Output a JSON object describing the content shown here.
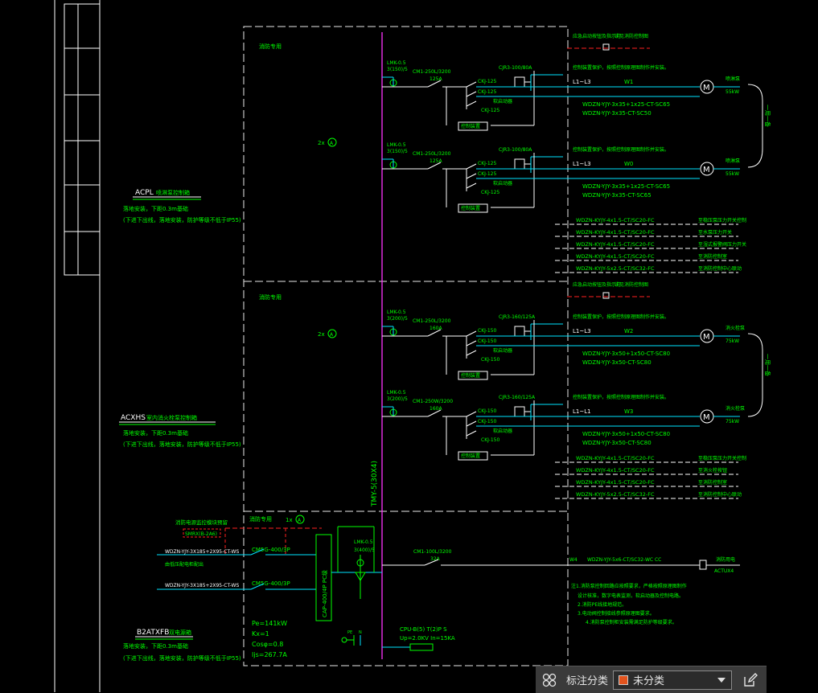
{
  "colors": {
    "background": "#000000",
    "frame": "#ffffff",
    "dashed": "#e8e8e8",
    "green": "#00ff00",
    "cyan": "#00e5ff",
    "magenta": "#ff33ff",
    "red": "#ff2020",
    "toolbar_bg": "#3a3a3a",
    "swatch": "#e2531d"
  },
  "panels": [
    {
      "code": "ACPL",
      "name": "喷淋泵控制箱",
      "line2": "落地安装，下距0.3m基础",
      "line3": "(下进下出线，落地安装，防护等级不低于IP55)"
    },
    {
      "code": "ACXHS",
      "name": "室内消火栓泵控制箱",
      "line2": "落地安装，下距0.3m基础",
      "line3": "(下进下出线，落地安装，防护等级不低于IP55)"
    },
    {
      "code": "B2ATXFB",
      "name": "双电源箱",
      "line2": "落地安装，下距0.3m基础",
      "line3": "(下进下出线，落地安装，防护等级不低于IP55)"
    }
  ],
  "section_labels": [
    "消防专用",
    "消防专用",
    "消防专用"
  ],
  "busbar_label": "TMY-5(30X4)",
  "two_x": "2x",
  "one_x": "1x",
  "motor_circuits": [
    {
      "meter": "LMK-0.5",
      "ct": "3(150)/5",
      "breaker": "CM1-250L/3200",
      "rating": "125A",
      "contactor": "CJR3-100/80A",
      "k1": "CKJ-125",
      "k2": "CKJ-125",
      "k3": "CKJ-125",
      "ctrl": "控制装置",
      "starter": "软启动器",
      "line": "L1~L3",
      "loop": "W1",
      "cable1": "WDZN-YJY-3x35+1x25-CT-SC65",
      "cable2": "WDZN-YJY-3x35-CT-SC50",
      "note": "控制装置保护，按照控制原理图制作并安装。",
      "motor_label": "喷淋泵",
      "power": "55kW"
    },
    {
      "meter": "LMK-0.5",
      "ct": "3(150)/5",
      "breaker": "CM1-250L/3200",
      "rating": "125A",
      "contactor": "CJR3-100/80A",
      "k1": "CKJ-125",
      "k2": "CKJ-125",
      "k3": "CKJ-125",
      "ctrl": "控制装置",
      "starter": "软启动器",
      "line": "L1~L3",
      "loop": "W0",
      "cable1": "WDZN-YJY-3x35+1x25-CT-SC65",
      "cable2": "WDZN-YJY-3x35-CT-SC65",
      "note": "控制装置保护，按照控制原理图制作并安装。",
      "motor_label": "喷淋泵",
      "power": "55kW"
    },
    {
      "meter": "LMK-0.5",
      "ct": "3(200)/5",
      "breaker": "CM1-250L/3200",
      "rating": "160A",
      "contactor": "CJR3-160/125A",
      "k1": "CKJ-150",
      "k2": "CKJ-150",
      "k3": "CKJ-150",
      "ctrl": "控制装置",
      "starter": "软启动器",
      "line": "L1~L3",
      "loop": "W2",
      "cable1": "WDZN-YJY-3x50+1x50-CT-SC80",
      "cable2": "WDZN-YJY-3x50-CT-SC80",
      "note": "控制装置保护，按照控制原理图制作并安装。",
      "motor_label": "消火栓泵",
      "power": "75kW"
    },
    {
      "meter": "LMK-0.5",
      "ct": "3(200)/5",
      "breaker": "CM1-250W/3200",
      "rating": "160A",
      "contactor": "CJR3-160/125A",
      "k1": "CKJ-150",
      "k2": "CKJ-150",
      "k3": "CKJ-150",
      "ctrl": "控制装置",
      "starter": "软启动器",
      "line": "L1~L1",
      "loop": "W3",
      "cable1": "WDZN-YJY-3x50+1x50-CT-SC80",
      "cable2": "WDZN-YJY-3x50-CT-SC80",
      "note": "控制装置保护，按照控制原理图制作并安装。",
      "motor_label": "消火栓泵",
      "power": "75kW"
    }
  ],
  "control_cables_1": [
    {
      "cable": "WDZN-KYJY-4x1.5-CT/SC20-FC",
      "dest": "至稳压泵压力开关控制"
    },
    {
      "cable": "WDZN-KYJY-4x1.5-CT/SC20-FC",
      "dest": "至水泵压力开关"
    },
    {
      "cable": "WDZN-KYJY-4x1.5-CT/SC20-FC",
      "dest": "至湿式报警阀压力开关"
    },
    {
      "cable": "WDZN-KYJY-4x1.5-CT/SC20-FC",
      "dest": "至消防控制室"
    },
    {
      "cable": "WDZN-KYJY-5x2.5-CT/SC32-FC",
      "dest": "至消防控制中心联动"
    }
  ],
  "control_cables_2": [
    {
      "cable": "WDZN-KYJY-4x1.5-CT/SC20-FC",
      "dest": "至稳压泵压力开关控制"
    },
    {
      "cable": "WDZN-KYJY-4x1.5-CT/SC20-FC",
      "dest": "至消火栓按钮"
    },
    {
      "cable": "WDZN-KYJY-4x1.5-CT/SC20-FC",
      "dest": "至消防控制室"
    },
    {
      "cable": "WDZN-KYJY-5x2.5-CT/SC32-FC",
      "dest": "至消防控制中心联动"
    }
  ],
  "top_notes": [
    "应急启动按钮及指示灯",
    "详见消防控制图"
  ],
  "right_brackets": [
    "一用一备",
    "一用一备"
  ],
  "incoming": {
    "header": "消防电源监控模块预留",
    "box": "SMRX(B-2A6)",
    "cable1": "WDZN-YJY-3X185+2X95-CT-WS",
    "note1": "由低压配电柜配出",
    "cable2": "WDZN-YJY-3X185+2X95-CT-WS",
    "qf1": "CM5G-400/3P",
    "qf2": "CM5G-400/3P",
    "ats": "CAP-400/4P PC级",
    "meter": "LMK-0.5",
    "ct": "3(400)/5",
    "out_breaker": "CM1-100L/3200",
    "out_rating": "32A",
    "out_loop": "W4",
    "out_cable": "WDZN-YJY-5x6-CT/SC32-WC CC",
    "out_dest": "消防用电",
    "out_box": "ACTUX4",
    "spd": "CPU-B(5) T(2)P S",
    "spd2": "Up=2.0KV In=15KA",
    "pe": "PE",
    "n": "N",
    "calc": [
      "Pe=141kW",
      "Kx=1",
      "Cosφ=0.8",
      "Ijs=267.7A"
    ]
  },
  "notes": [
    "注1.消防泵控制回路应按照要求，严格按照原理图制作",
    "设计核准，数字电表监测，软启动器及控制电路。",
    "2.消防PE线接地规范。",
    "3.电动阀控制接线参照原理图要求。",
    "4.消防泵控制柜安装需满足防护等级要求。"
  ],
  "toolbar": {
    "grid_icon": "grid-icon",
    "label": "标注分类",
    "select_value": "未分类",
    "swatch_color": "#e2531d",
    "edit_icon": "edit-icon"
  }
}
